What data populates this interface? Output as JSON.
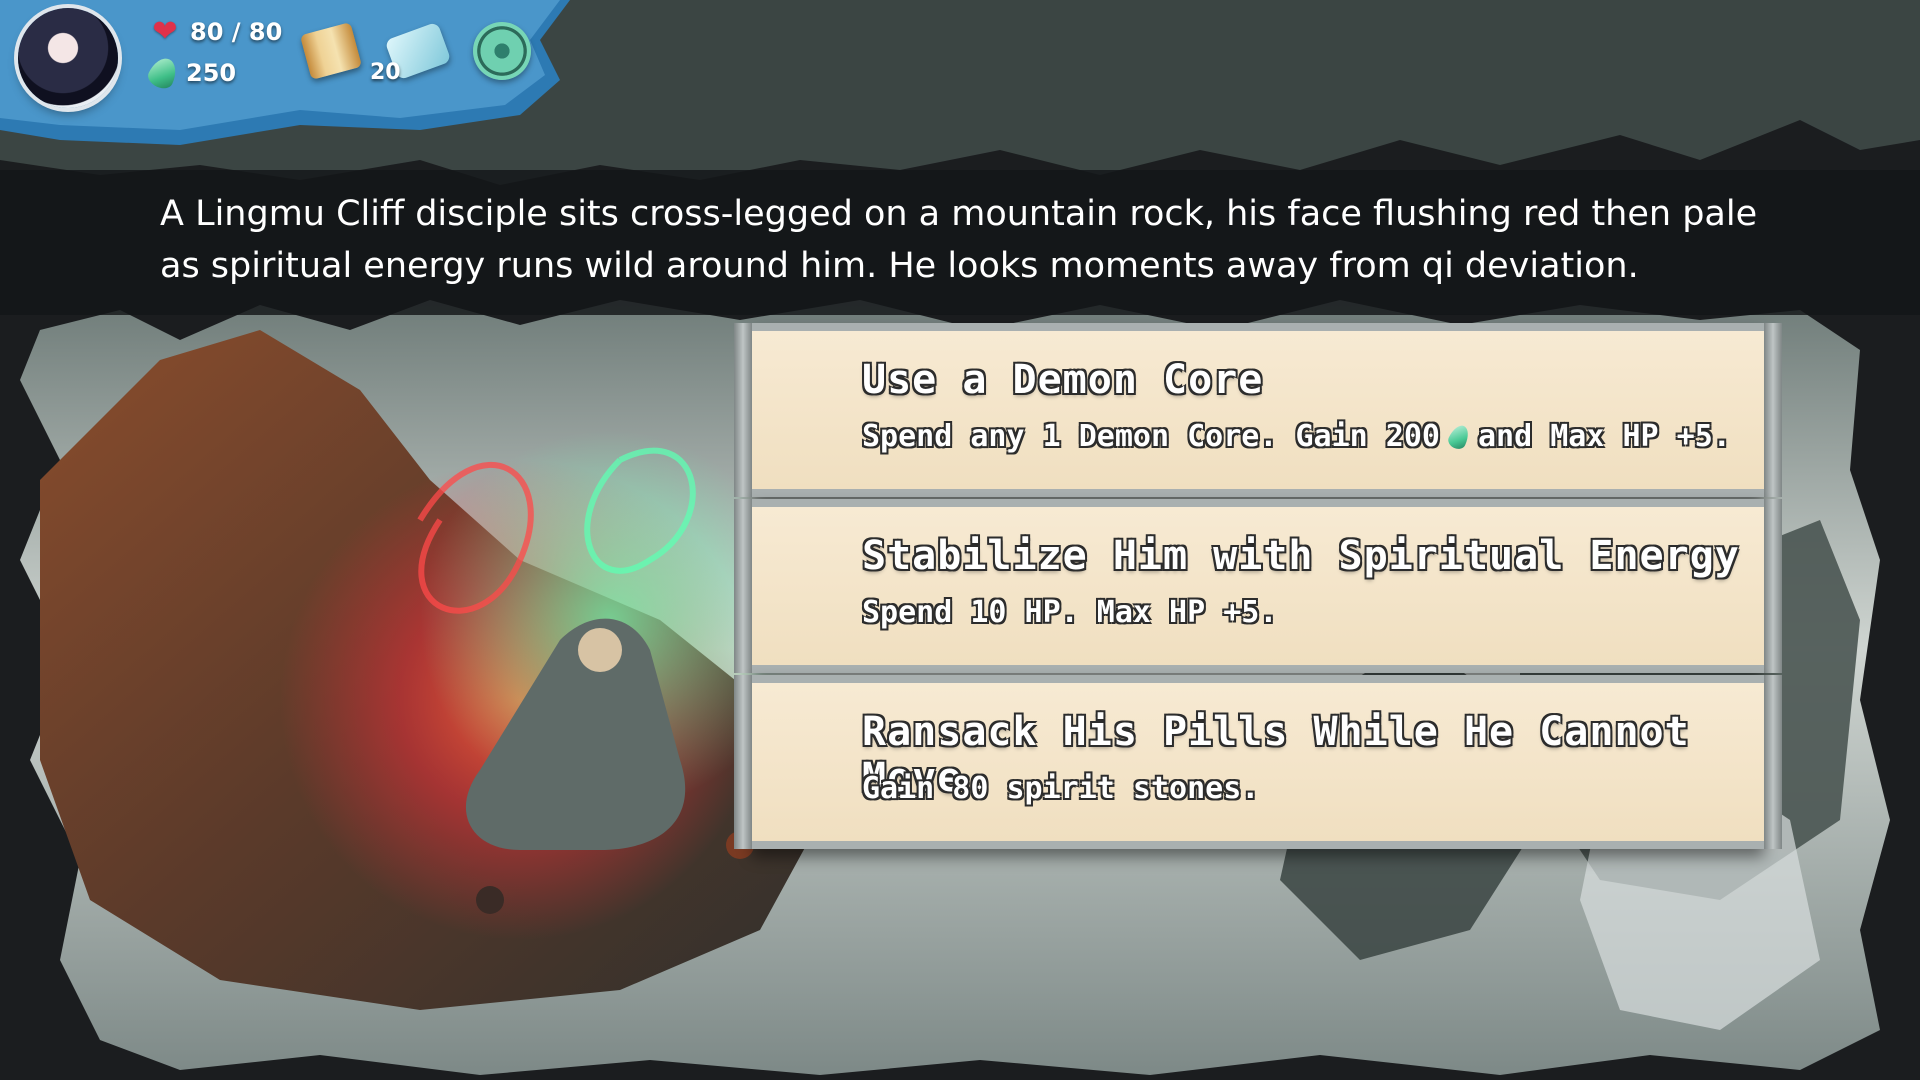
{
  "hud": {
    "hp": "80 / 80",
    "spirit_stones": "250",
    "deck_count": "20"
  },
  "narrative": {
    "text": "A Lingmu Cliff disciple sits cross-legged on a mountain rock, his face flushing red then pale as spiritual energy runs wild around him. He looks moments away from qi deviation."
  },
  "choices": [
    {
      "title": "Use a Demon Core",
      "desc_before": "Spend any 1 Demon Core. Gain 200",
      "desc_after": "and Max HP +5."
    },
    {
      "title": "Stabilize Him with Spiritual Energy",
      "desc": "Spend 10 HP. Max HP +5."
    },
    {
      "title": "Ransack His Pills While He Cannot Move",
      "desc": "Gain 80 spirit stones."
    }
  ],
  "icons": {
    "heart": "heart-icon",
    "gem": "spirit-stone-icon",
    "map": "scroll-map-icon",
    "deck": "card-deck-icon",
    "settings": "gear-icon"
  },
  "colors": {
    "background": "#1b1d1f",
    "parchment": "#f3e4c8",
    "gem": "#3fbf88",
    "heart": "#e0314a"
  }
}
